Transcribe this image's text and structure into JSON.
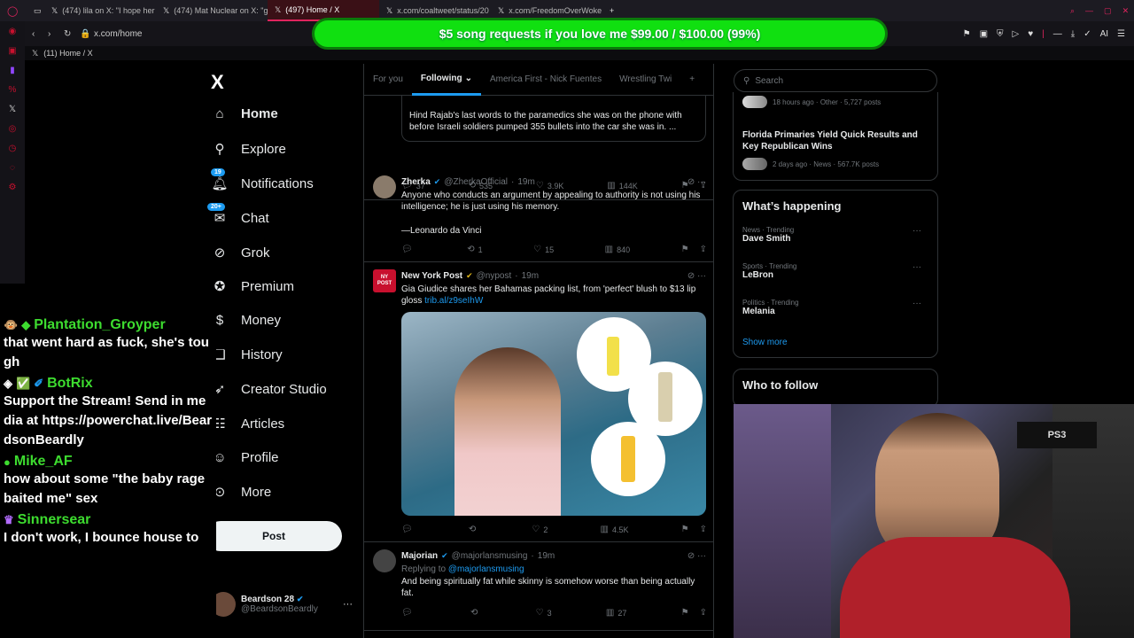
{
  "browser": {
    "tabs": [
      {
        "label": "(474) lila on X: \"I hope her"
      },
      {
        "label": "(474) Mat Nuclear on X: \"g"
      },
      {
        "label": "(497) Home / X"
      },
      {
        "label": "x.com/coaltweet/status/20"
      },
      {
        "label": "x.com/FreedomOverWoke"
      }
    ],
    "url": "x.com/home",
    "bookmark": "(11) Home / X",
    "ai_label": "AI"
  },
  "donation": {
    "text": "$5 song requests if you love me $99.00 / $100.00 (99%)",
    "progress": 0.99,
    "color": "#10e010"
  },
  "nav": {
    "logo": "X",
    "items": [
      {
        "label": "Home",
        "icon": "home-icon"
      },
      {
        "label": "Explore",
        "icon": "search-icon"
      },
      {
        "label": "Notifications",
        "icon": "bell-icon",
        "badge": "19"
      },
      {
        "label": "Chat",
        "icon": "chat-icon",
        "badge": "20+"
      },
      {
        "label": "Grok",
        "icon": "grok-icon"
      },
      {
        "label": "Premium",
        "icon": "premium-icon"
      },
      {
        "label": "Money",
        "icon": "money-icon"
      },
      {
        "label": "History",
        "icon": "bookmark-icon"
      },
      {
        "label": "Creator Studio",
        "icon": "rocket-icon"
      },
      {
        "label": "Articles",
        "icon": "article-icon"
      },
      {
        "label": "Profile",
        "icon": "person-icon"
      },
      {
        "label": "More",
        "icon": "more-icon"
      }
    ],
    "post_button": "Post",
    "profile": {
      "name": "Beardson 28",
      "handle": "@BeardsonBeardly",
      "more": "···"
    }
  },
  "chat": [
    {
      "user": "Plantation_Groyper",
      "text": "that went hard as fuck, she's tough"
    },
    {
      "user": "BotRix",
      "text": "Support the Stream! Send in media at https://powerchat.live/BeardsonBeardly"
    },
    {
      "user": "Mike_AF",
      "text": "how about some \"the baby rage baited me\" sex"
    },
    {
      "user": "Sinnersear",
      "text": "I don't work, I bounce house to"
    }
  ],
  "timeline": {
    "tabs": [
      "For you",
      "Following",
      "America First - Nick Fuentes",
      "Wrestling Twi",
      "+"
    ],
    "tweets": [
      {
        "body": "Hind Rajab's last words to the paramedics she was on the phone with before Israeli soldiers pumped 355 bullets into the car she was in. ...",
        "stats": {
          "replies": "37",
          "reposts": "535",
          "likes": "3.9K",
          "views": "144K"
        }
      },
      {
        "name": "Zherka",
        "handle": "@ZherkaOfficial",
        "time": "19m",
        "body": "Anyone who conducts an argument by appealing to authority is not using his intelligence; he is just using his memory.",
        "body2": "—Leonardo da Vinci",
        "stats": {
          "replies": "",
          "reposts": "1",
          "likes": "15",
          "views": "840"
        }
      },
      {
        "name": "New York Post",
        "handle": "@nypost",
        "time": "19m",
        "body": "Gia Giudice shares her Bahamas packing list, from 'perfect' blush to $13 lip gloss",
        "link": "trib.al/z9seIhW",
        "stats": {
          "replies": "",
          "reposts": "",
          "likes": "2",
          "views": "4.5K"
        }
      },
      {
        "name": "Majorian",
        "handle": "@majorlansmusing",
        "time": "19m",
        "reply_prefix": "Replying to",
        "reply_to": "@majorlansmusing",
        "body": "And being spiritually fat while skinny is somehow worse than being actually fat.",
        "stats": {
          "replies": "",
          "reposts": "",
          "likes": "3",
          "views": "27"
        }
      }
    ]
  },
  "right": {
    "search_placeholder": "Search",
    "top_meta": "18 hours ago · Other · 5,727 posts",
    "story_title": "Florida Primaries Yield Quick Results and Key Republican Wins",
    "story_meta": "2 days ago · News · 567.7K posts",
    "happening_title": "What’s happening",
    "trends": [
      {
        "category": "News · Trending",
        "name": "Dave Smith"
      },
      {
        "category": "Sports · Trending",
        "name": "LeBron"
      },
      {
        "category": "Politics · Trending",
        "name": "Melania"
      }
    ],
    "show_more": "Show more",
    "who_to_follow": "Who to follow"
  }
}
